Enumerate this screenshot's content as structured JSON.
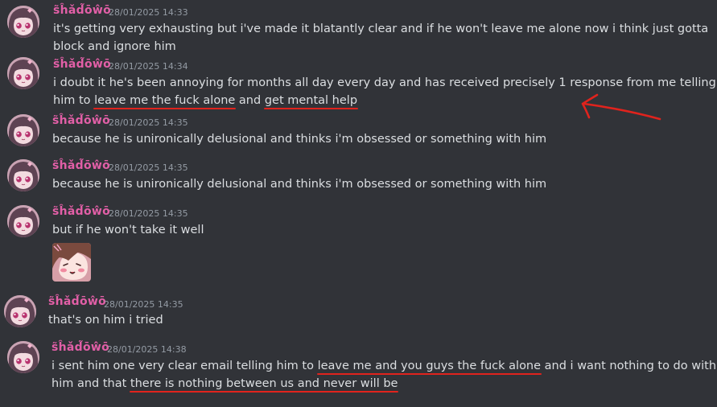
{
  "messages": [
    {
      "author": "s̃ĥǎd̃ōŵō",
      "timestamp": "28/01/2025 14:33",
      "line1": "it's getting very exhausting but i've made it blatantly clear and if he won't leave me alone now i think just gotta",
      "line2": "block and ignore him"
    },
    {
      "author": "s̃ĥǎd̃ōŵō",
      "timestamp": "28/01/2025 14:34",
      "line1": "i doubt it he's been annoying for months all day every day and has received precisely 1 response from me telling",
      "line2_pre": "him to ",
      "line2_hl1": "leave me the fuck alone",
      "line2_mid": " and ",
      "line2_hl2": "get mental help"
    },
    {
      "author": "s̃ĥǎd̃ōŵō",
      "timestamp": "28/01/2025 14:35",
      "line1": "because he is unironically delusional and thinks i'm obsessed or something with him"
    },
    {
      "author": "s̃ĥǎd̃ōŵō",
      "timestamp": "28/01/2025 14:35",
      "line1": "because he is unironically delusional and thinks i'm obsessed or something with him"
    },
    {
      "author": "s̃ĥǎd̃ōŵō",
      "timestamp": "28/01/2025 14:35",
      "line1": "but if he won't take it well"
    },
    {
      "author": "s̃ĥǎd̃ōŵō",
      "timestamp": "28/01/2025 14:35",
      "line1": "that's on him i tried"
    },
    {
      "author": "s̃ĥǎd̃ōŵō",
      "timestamp": "28/01/2025 14:38",
      "line1_pre": "i sent him one very clear email telling him to ",
      "line1_hl": "leave me and you guys the fuck alone",
      "line1_post": " and i want nothing to do with",
      "line2_pre": "him and that ",
      "line2_hl": "there is nothing between us and never will be"
    }
  ],
  "colors": {
    "background": "#313338",
    "username": "#e25fa7",
    "timestamp": "#949ba4",
    "text": "#dbdee1",
    "annotation": "#e0231d"
  },
  "icons": [
    "avatar-image",
    "emoji-sticker",
    "red-arrow-annotation"
  ]
}
